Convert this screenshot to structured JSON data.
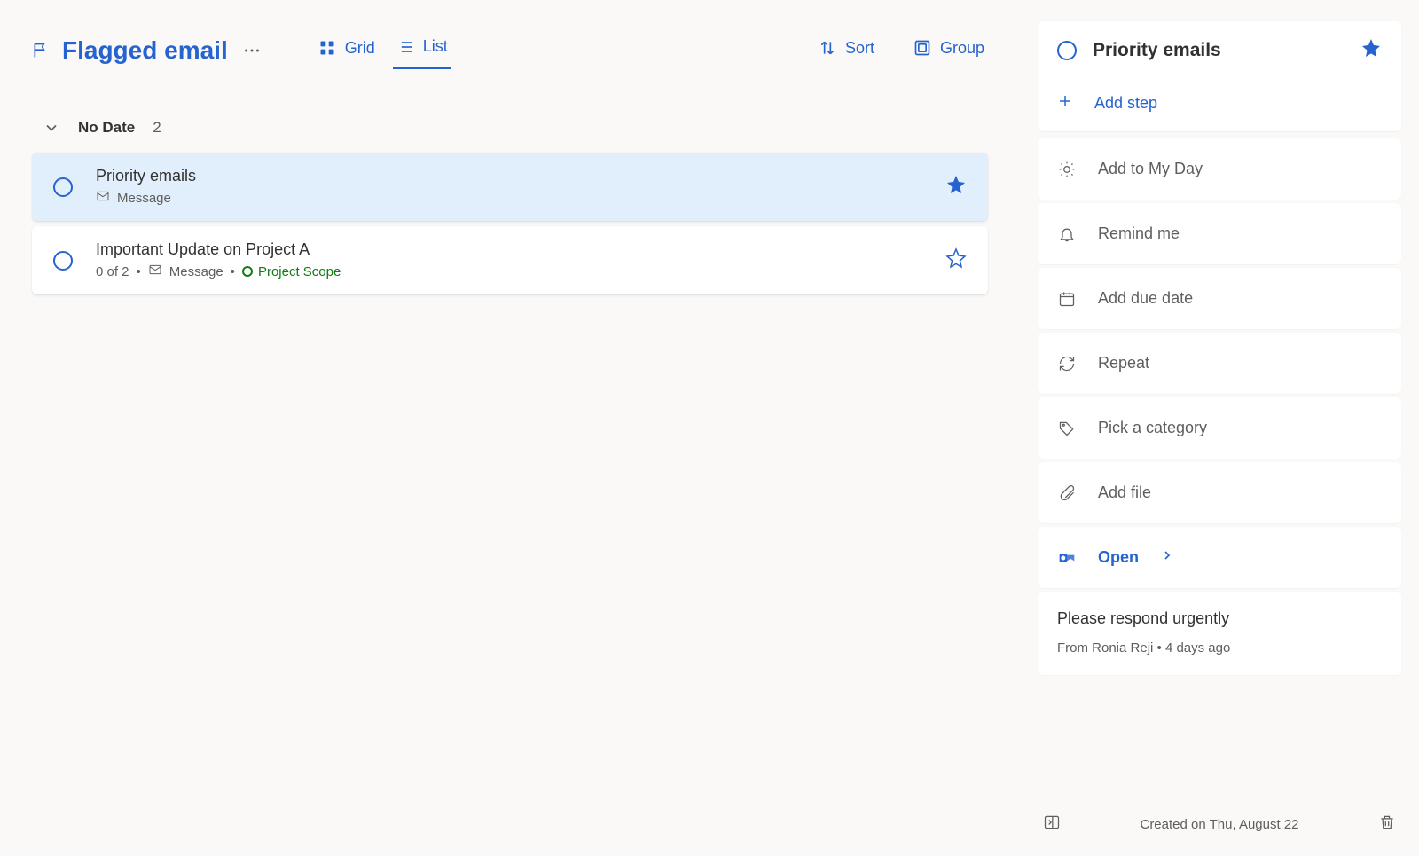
{
  "header": {
    "title": "Flagged email",
    "view_grid": "Grid",
    "view_list": "List",
    "sort": "Sort",
    "group": "Group"
  },
  "group": {
    "name": "No Date",
    "count": "2"
  },
  "tasks": [
    {
      "title": "Priority emails",
      "meta_label": "Message",
      "important": true,
      "selected": true
    },
    {
      "title": "Important Update on Project A",
      "steps": "0 of 2",
      "meta_label": "Message",
      "category": "Project Scope",
      "important": false,
      "selected": false
    }
  ],
  "detail": {
    "title": "Priority emails",
    "add_step": "Add step",
    "items": {
      "my_day": "Add to My Day",
      "remind": "Remind me",
      "due": "Add due date",
      "repeat": "Repeat",
      "category": "Pick a category",
      "file": "Add file",
      "open": "Open"
    },
    "email": {
      "subject": "Please respond urgently",
      "from": "From Ronia Reji  •  4 days ago"
    },
    "created": "Created on Thu, August 22"
  }
}
